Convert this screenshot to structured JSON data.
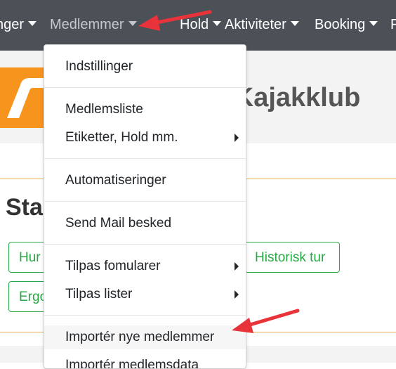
{
  "navbar": {
    "items": [
      {
        "label": "nger"
      },
      {
        "label": "Medlemmer"
      },
      {
        "label": "Hold"
      },
      {
        "label": "Aktiviteter"
      },
      {
        "label": "Booking"
      },
      {
        "label": "F"
      }
    ]
  },
  "header": {
    "club_name": "g Kajakklub"
  },
  "main": {
    "section_title": "Star",
    "buttons": [
      {
        "label": "Hur"
      },
      {
        "label": "Historisk tur"
      },
      {
        "label": "Ergo"
      }
    ]
  },
  "dropdown": {
    "items": [
      {
        "label": "Indstillinger"
      },
      {
        "label": "Medlemsliste"
      },
      {
        "label": "Etiketter, Hold mm."
      },
      {
        "label": "Automatiseringer"
      },
      {
        "label": "Send Mail besked"
      },
      {
        "label": "Tilpas fomularer"
      },
      {
        "label": "Tilpas lister"
      },
      {
        "label": "Importér nye medlemmer"
      },
      {
        "label": "Importér medlemsdata"
      }
    ]
  },
  "colors": {
    "navbar_bg": "#4b5157",
    "accent_green": "#28a745",
    "logo_orange": "#f7941d",
    "annotation_red": "#e8333a"
  }
}
